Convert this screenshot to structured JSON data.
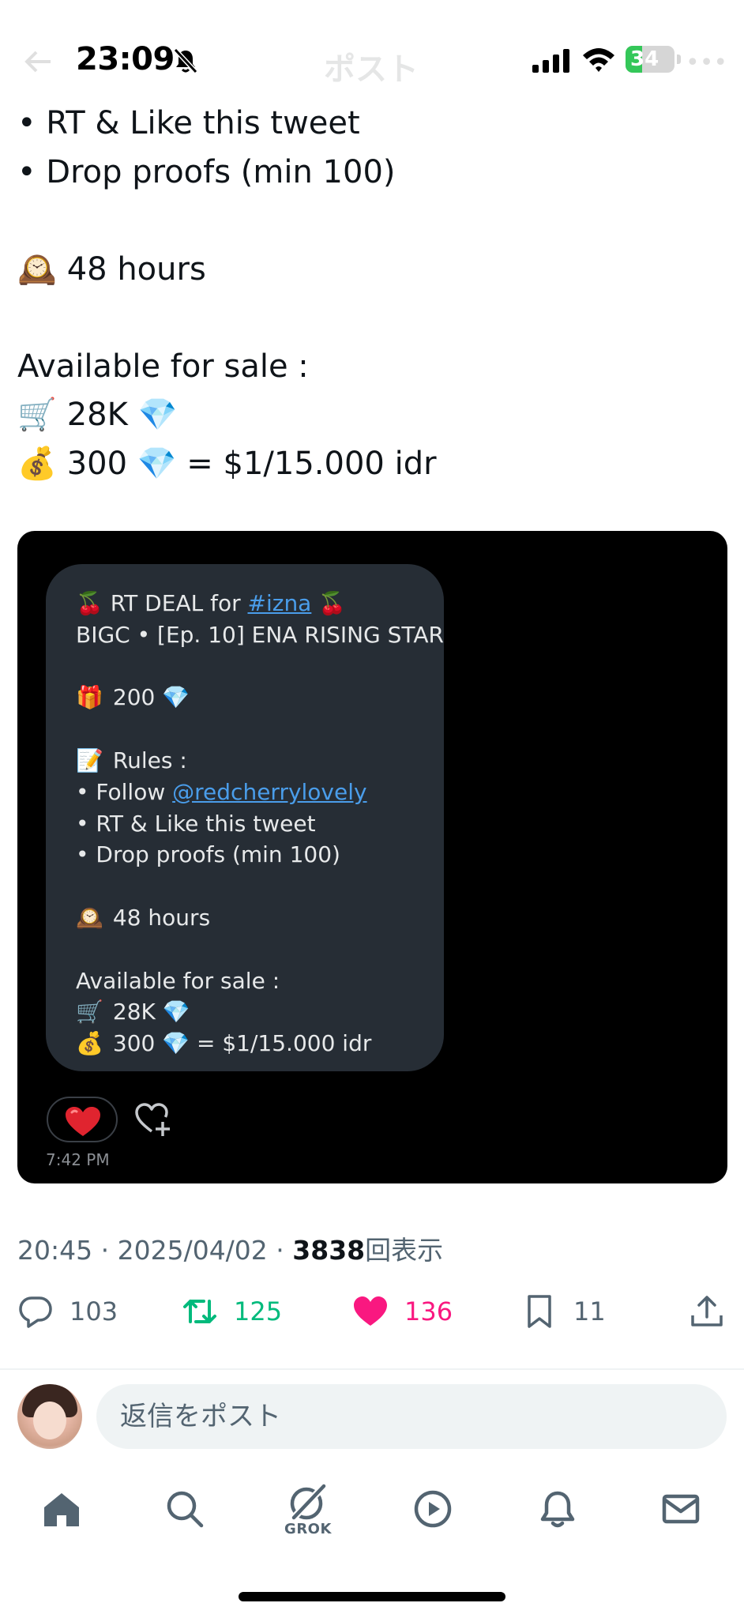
{
  "status_bar": {
    "time": "23:09",
    "battery_percent": 34,
    "battery_label": "34",
    "header_title": "ポスト"
  },
  "tweet": {
    "lines": [
      {
        "emoji": "",
        "text": "• RT & Like this tweet"
      },
      {
        "emoji": "",
        "text": "• Drop proofs (min 100)"
      },
      {
        "emoji": "",
        "text": ""
      },
      {
        "emoji": "🕰️",
        "text": " 48 hours"
      },
      {
        "emoji": "",
        "text": ""
      },
      {
        "emoji": "",
        "text": "Available for sale :"
      },
      {
        "emoji": "🛒",
        "text": " 28K 💎"
      },
      {
        "emoji": "💰",
        "text": " 300 💎 = $1/15.000 idr"
      }
    ]
  },
  "media": {
    "bubble": {
      "title_prefix": "🍒 RT DEAL for ",
      "title_hashtag": "#izna",
      "title_suffix": " 🍒",
      "subtitle": "BIGC • [Ep. 10] ENA RISING STAR",
      "gift_emoji": "🎁",
      "gift_text": " 200 💎",
      "rules_emoji": "📝",
      "rules_text": " Rules :",
      "follow_prefix": "• Follow ",
      "follow_handle": "@redcherrylovely",
      "rule_rt": "• RT & Like this tweet",
      "rule_proofs": "• Drop proofs (min 100)",
      "clock_emoji": "🕰️",
      "hours_text": " 48 hours",
      "available": "Available for sale :",
      "cart_emoji": "🛒",
      "stock_text": " 28K 💎",
      "bag_emoji": "💰",
      "price_text": " 300 💎 = $1/15.000 idr"
    },
    "message_time": "7:42 PM"
  },
  "meta": {
    "time": "20:45",
    "date": "2025/04/02",
    "views": "3838",
    "views_label": "回表示"
  },
  "actions": {
    "replies": "103",
    "retweets": "125",
    "likes": "136",
    "bookmarks": "11"
  },
  "reply_bar": {
    "placeholder": "返信をポスト"
  },
  "nav": {
    "grok_label": "GROK"
  },
  "colors": {
    "retweet_green": "#00ba7c",
    "like_pink": "#f91880",
    "secondary_text": "#536471",
    "link_blue": "#4a9dea",
    "battery_green": "#34c759"
  }
}
